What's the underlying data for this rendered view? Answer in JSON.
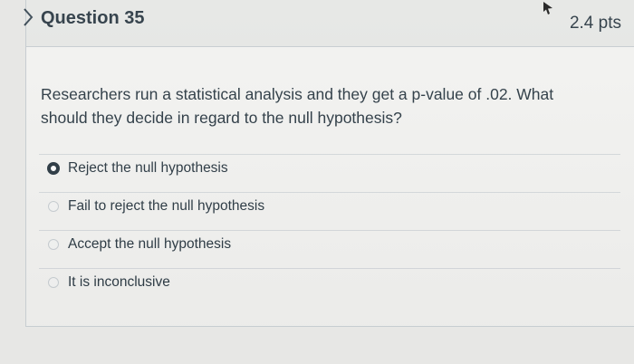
{
  "question": {
    "title": "Question 35",
    "points": "2.4 pts",
    "text": "Researchers run a statistical analysis and they get a p-value of .02. What should they decide in regard to the null hypothesis?"
  },
  "answers": [
    {
      "label": "Reject the null hypothesis",
      "selected": true
    },
    {
      "label": "Fail to reject the null hypothesis",
      "selected": false
    },
    {
      "label": "Accept the null hypothesis",
      "selected": false
    },
    {
      "label": "It is inconclusive",
      "selected": false
    }
  ],
  "colors": {
    "text": "#2d3b45",
    "header_bg": "#e6e7e5",
    "card_bg": "#f3f3f1",
    "border": "#c7cdd1"
  }
}
